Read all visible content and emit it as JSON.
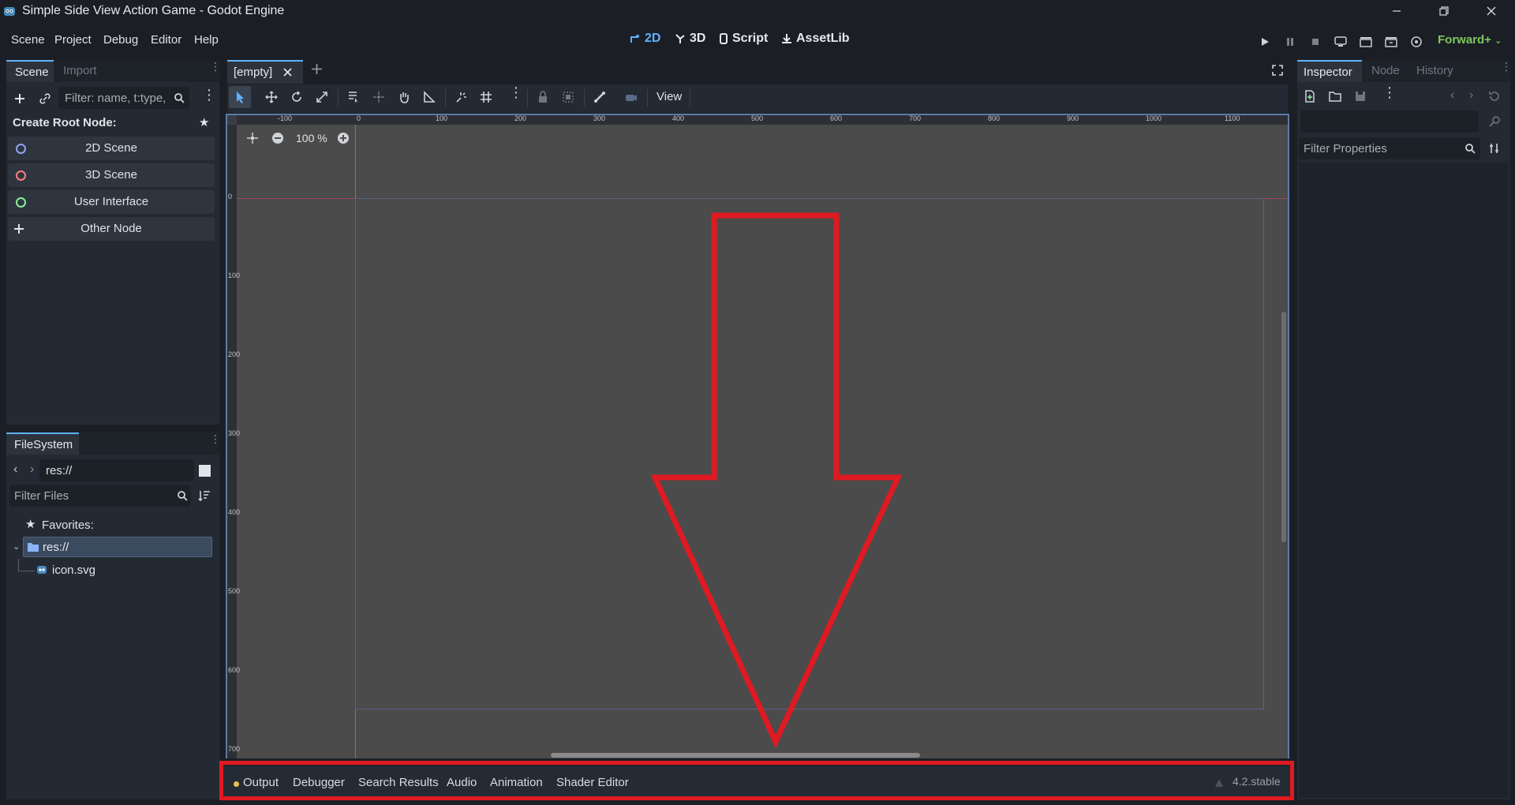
{
  "window": {
    "title": "Simple Side View Action Game - Godot Engine"
  },
  "menu": [
    "Scene",
    "Project",
    "Debug",
    "Editor",
    "Help"
  ],
  "workspaces": [
    {
      "label": "2D",
      "active": true
    },
    {
      "label": "3D",
      "active": false
    },
    {
      "label": "Script",
      "active": false
    },
    {
      "label": "AssetLib",
      "active": false
    }
  ],
  "renderer": "Forward+",
  "scene_dock": {
    "tabs": [
      "Scene",
      "Import"
    ],
    "filter_placeholder": "Filter: name, t:type,",
    "create_root_label": "Create Root Node:",
    "root_buttons": [
      {
        "label": "2D Scene",
        "color": "#8da5f3"
      },
      {
        "label": "3D Scene",
        "color": "#fc7f7f"
      },
      {
        "label": "User Interface",
        "color": "#8eef97"
      },
      {
        "label": "Other Node",
        "color": ""
      }
    ]
  },
  "filesystem": {
    "tab": "FileSystem",
    "path": "res://",
    "filter_placeholder": "Filter Files",
    "favorites_label": "Favorites:",
    "root_label": "res://",
    "files": [
      "icon.svg"
    ]
  },
  "editor": {
    "tab_label": "[empty]",
    "view_menu": "View",
    "zoom_label": "100 %"
  },
  "ruler": {
    "top_labels": [
      "-100",
      "0",
      "100",
      "200",
      "300",
      "400",
      "500",
      "600",
      "700",
      "800",
      "900",
      "1000",
      "1100"
    ],
    "left_labels": [
      "0",
      "100",
      "200",
      "300",
      "400",
      "500",
      "600",
      "700"
    ]
  },
  "inspector": {
    "tabs": [
      "Inspector",
      "Node",
      "History"
    ],
    "filter_placeholder": "Filter Properties"
  },
  "bottom_panel": {
    "tabs": [
      "Output",
      "Debugger",
      "Search Results",
      "Audio",
      "Animation",
      "Shader Editor"
    ],
    "version": "4.2.stable"
  },
  "colors": {
    "accent": "#5fb2ff",
    "annotation_red": "#e01a22",
    "renderer_green": "#7fc760",
    "output_dot": "#e3c64b"
  }
}
